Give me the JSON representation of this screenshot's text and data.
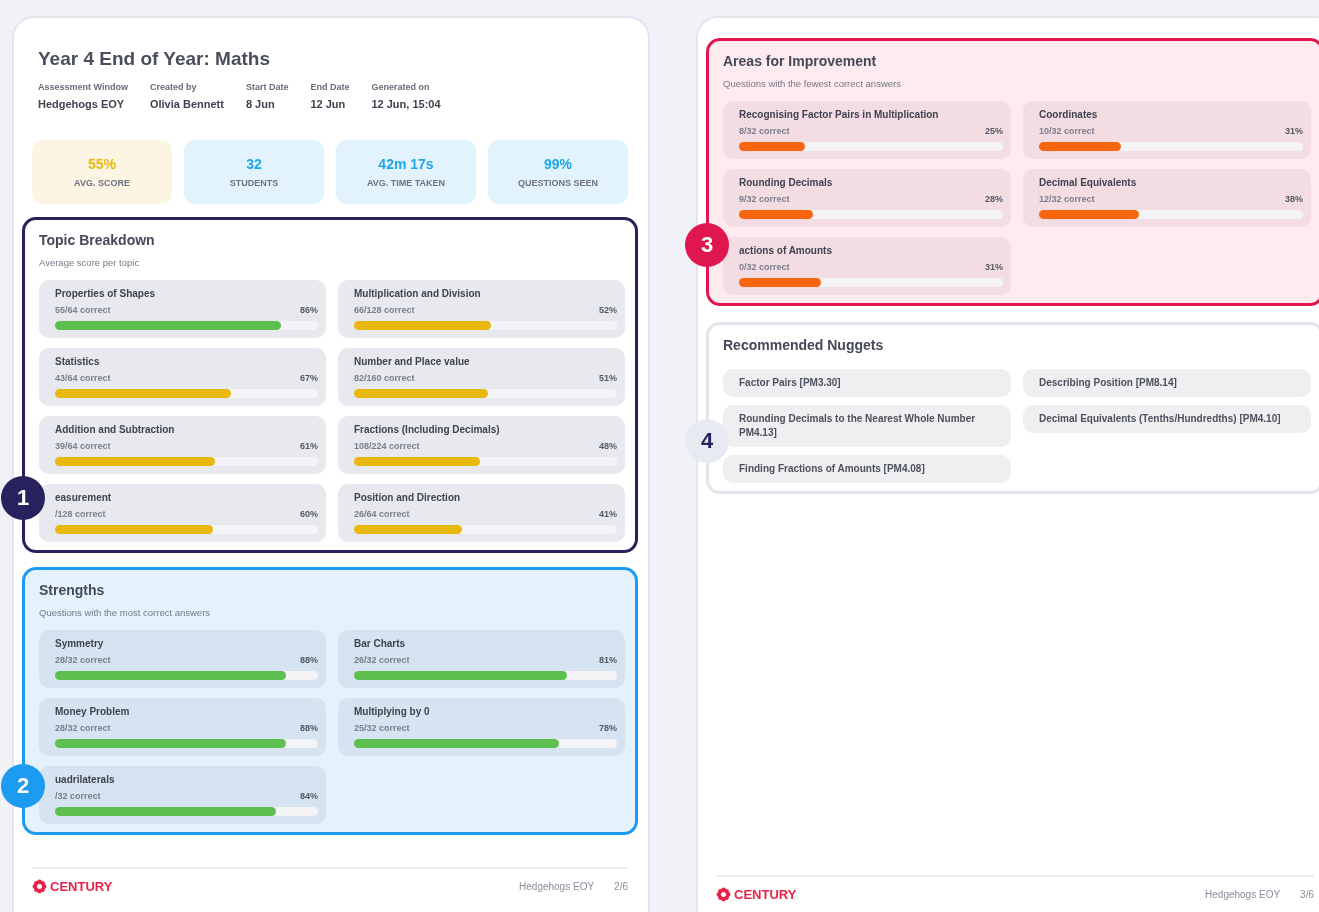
{
  "pages": [
    {
      "title": "Year 4 End of Year: Maths",
      "meta": [
        {
          "label": "Assessment Window",
          "value": "Hedgehogs EOY"
        },
        {
          "label": "Created by",
          "value": "Olivia Bennett"
        },
        {
          "label": "Start Date",
          "value": "8 Jun"
        },
        {
          "label": "End Date",
          "value": "12 Jun"
        },
        {
          "label": "Generated on",
          "value": "12 Jun, 15:04"
        }
      ],
      "stats": [
        {
          "kind": "score",
          "value": "55%",
          "label": "AVG. SCORE"
        },
        {
          "kind": "info",
          "value": "32",
          "label": "STUDENTS"
        },
        {
          "kind": "info",
          "value": "42m 17s",
          "label": "AVG. TIME TAKEN"
        },
        {
          "kind": "info",
          "value": "99%",
          "label": "QUESTIONS SEEN"
        }
      ],
      "sections": [
        {
          "kind": "topic",
          "badge": "1",
          "title": "Topic Breakdown",
          "subtitle": "Average score per topic",
          "items": [
            {
              "name": "Properties of Shapes",
              "correct": "55/64 correct",
              "percent": "86%",
              "level": 0.86,
              "color": "#5cbf4f"
            },
            {
              "name": "Multiplication and Division",
              "correct": "66/128 correct",
              "percent": "52%",
              "level": 0.52,
              "color": "#e9b80c"
            },
            {
              "name": "Statistics",
              "correct": "43/64 correct",
              "percent": "67%",
              "level": 0.67,
              "color": "#e9b80c"
            },
            {
              "name": "Number and Place value",
              "correct": "82/160 correct",
              "percent": "51%",
              "level": 0.51,
              "color": "#e9b80c"
            },
            {
              "name": "Addition and Subtraction",
              "correct": "39/64 correct",
              "percent": "61%",
              "level": 0.61,
              "color": "#e9b80c"
            },
            {
              "name": "Fractions (Including Decimals)",
              "correct": "108/224 correct",
              "percent": "48%",
              "level": 0.48,
              "color": "#e9b80c"
            },
            {
              "name": "easurement",
              "correct": "/128 correct",
              "percent": "60%",
              "level": 0.6,
              "color": "#e9b80c"
            },
            {
              "name": "Position and Direction",
              "correct": "26/64 correct",
              "percent": "41%",
              "level": 0.41,
              "color": "#e9b80c"
            }
          ]
        },
        {
          "kind": "strengths",
          "badge": "2",
          "title": "Strengths",
          "subtitle": "Questions with the most correct answers",
          "items": [
            {
              "name": "Symmetry",
              "correct": "28/32 correct",
              "percent": "88%",
              "level": 0.88,
              "color": "#5cbf4f"
            },
            {
              "name": "Bar Charts",
              "correct": "26/32 correct",
              "percent": "81%",
              "level": 0.81,
              "color": "#5cbf4f"
            },
            {
              "name": "Money Problem",
              "correct": "28/32 correct",
              "percent": "88%",
              "level": 0.88,
              "color": "#5cbf4f"
            },
            {
              "name": "Multiplying by 0",
              "correct": "25/32 correct",
              "percent": "78%",
              "level": 0.78,
              "color": "#5cbf4f"
            },
            {
              "name": "uadrilaterals",
              "correct": "/32 correct",
              "percent": "84%",
              "level": 0.84,
              "color": "#5cbf4f"
            }
          ]
        }
      ],
      "footer": {
        "brand": "CENTURY",
        "document": "Hedgehogs EOY",
        "page": "2/6"
      }
    },
    {
      "sections": [
        {
          "kind": "improvement",
          "badge": "3",
          "title": "Areas for Improvement",
          "subtitle": "Questions with the fewest correct answers",
          "items": [
            {
              "name": "Recognising Factor Pairs in Multiplication",
              "correct": "8/32 correct",
              "percent": "25%",
              "level": 0.25,
              "color": "#f7650f"
            },
            {
              "name": "Coordinates",
              "correct": "10/32 correct",
              "percent": "31%",
              "level": 0.31,
              "color": "#f7650f"
            },
            {
              "name": "Rounding Decimals",
              "correct": "9/32 correct",
              "percent": "28%",
              "level": 0.28,
              "color": "#f7650f"
            },
            {
              "name": "Decimal Equivalents",
              "correct": "12/32 correct",
              "percent": "38%",
              "level": 0.38,
              "color": "#f7650f"
            },
            {
              "name": "actions of Amounts",
              "correct": "0/32 correct",
              "percent": "31%",
              "level": 0.31,
              "color": "#f7650f"
            }
          ]
        },
        {
          "kind": "nuggets",
          "badge": "4",
          "title": "Recommended Nuggets",
          "items": [
            {
              "name": "Factor Pairs [PM3.30]"
            },
            {
              "name": "Describing Position [PM8.14]"
            },
            {
              "name": "Rounding Decimals to the Nearest Whole Number PM4.13]"
            },
            {
              "name": "Decimal Equivalents (Tenths/Hundredths) [PM4.10]"
            },
            {
              "name": "Finding Fractions of Amounts [PM4.08]"
            }
          ]
        }
      ],
      "footer": {
        "brand": "CENTURY",
        "document": "Hedgehogs EOY",
        "page": "3/6"
      }
    }
  ]
}
